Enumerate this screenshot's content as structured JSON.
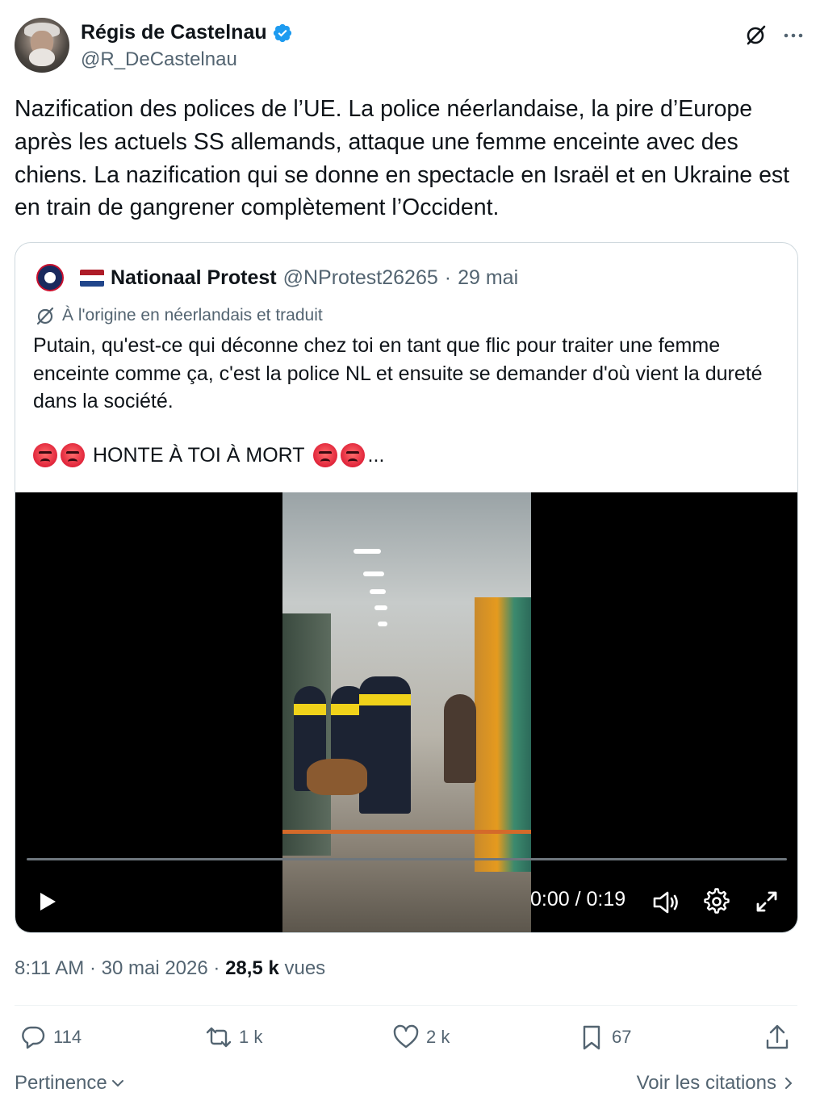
{
  "author": {
    "name": "Régis de Castelnau",
    "handle": "@R_DeCastelnau",
    "verified": true
  },
  "tweet": {
    "text": "Nazification des polices de l’UE. La police néerlandaise, la pire d’Europe après les actuels SS allemands, attaque une femme enceinte avec des chiens. La nazification qui se donne en spectacle en Israël et en Ukraine est en train de gangrener complètement l’Occident."
  },
  "quote": {
    "name": "Nationaal Protest",
    "handle": "@NProtest26265",
    "separator": "·",
    "date": "29 mai",
    "translated_label": "À l'origine en néerlandais et traduit",
    "text": "Putain, qu'est-ce qui déconne chez toi en tant que flic pour traiter une femme enceinte comme ça, c'est la police NL et ensuite se demander d'où vient la dureté dans la société.",
    "shout": "HONTE À TOI À MORT",
    "ellipsis": "...",
    "video": {
      "time": "0:00 / 0:19",
      "progress_percent": 0
    }
  },
  "meta": {
    "time": "8:11 AM",
    "dot": "·",
    "date": "30 mai 2026",
    "views_count": "28,5 k",
    "views_label": "vues"
  },
  "actions": {
    "replies": "114",
    "reposts": "1 k",
    "likes": "2 k",
    "bookmarks": "67"
  },
  "footer": {
    "sort_label": "Pertinence",
    "quotes_label": "Voir les citations"
  },
  "colors": {
    "text": "#0f1419",
    "secondary": "#536471",
    "verified": "#1d9bf0",
    "border": "#cfd9de"
  }
}
